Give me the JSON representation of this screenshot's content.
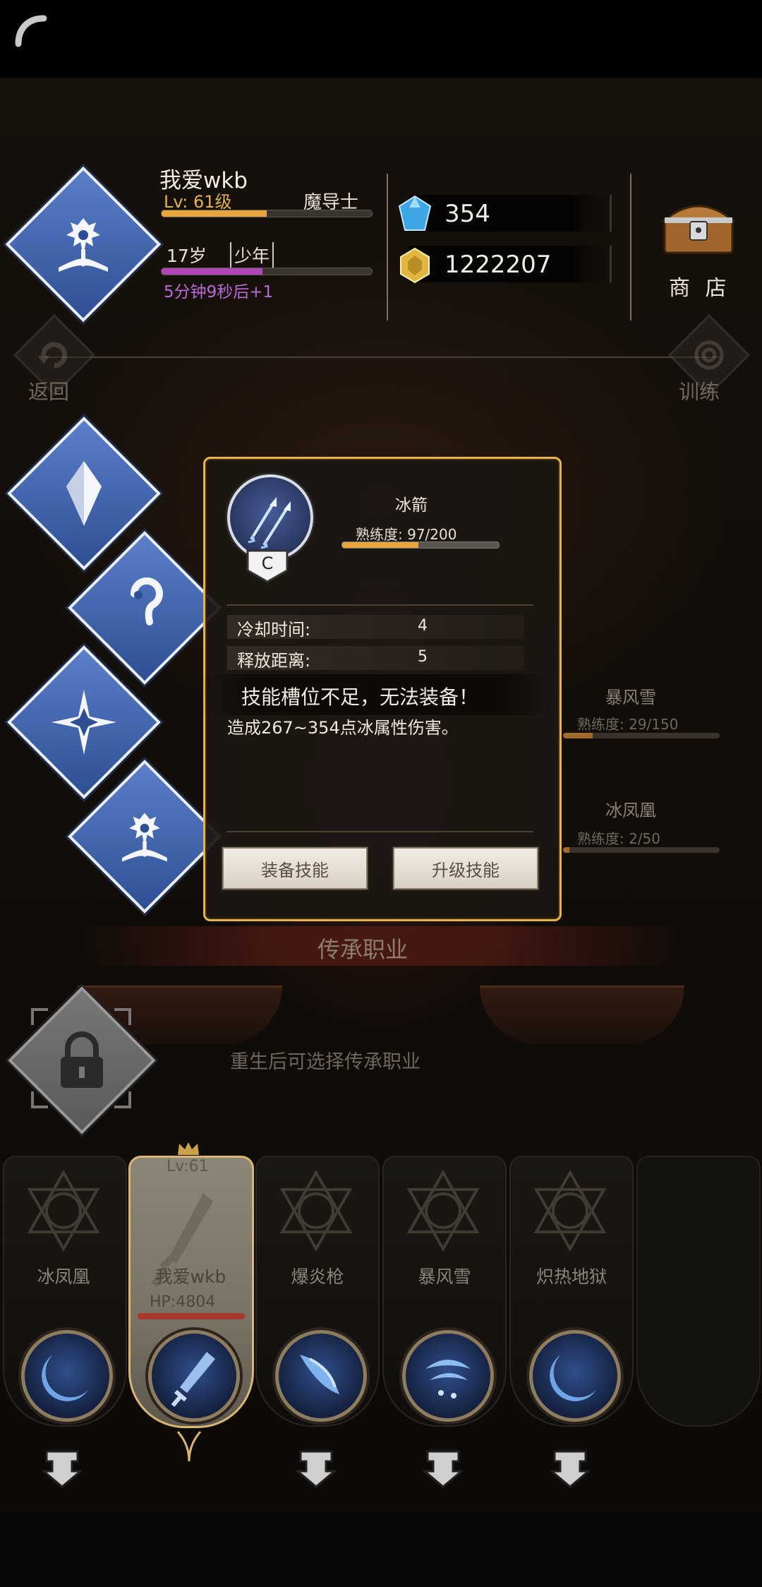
{
  "player": {
    "name": "我爱wkb",
    "level": "Lv: 61级",
    "class": "魔导士",
    "exp_progress": 0.5,
    "age": "17岁",
    "stage": "少年",
    "age_progress": 0.48,
    "timer": "5分钟9秒后+1"
  },
  "currency": {
    "gems": "354",
    "gold": "1222207"
  },
  "nav": {
    "shop": "商 店",
    "back": "返回",
    "train": "训练"
  },
  "background_skills": [
    {
      "name": "暴风雪",
      "proficiency": "熟练度: 29/150",
      "progress": 0.19
    },
    {
      "name": "冰凤凰",
      "proficiency": "熟练度: 2/50",
      "progress": 0.04
    }
  ],
  "toast": "技能槽位不足，无法装备！",
  "modal": {
    "skill_name": "冰箭",
    "proficiency_label": "熟练度: 97/200",
    "proficiency_progress": 0.485,
    "grade": "C",
    "stats": [
      {
        "label": "冷却时间:",
        "value": "4"
      },
      {
        "label": "释放距离:",
        "value": "5"
      }
    ],
    "description": "造成267~354点冰属性伤害。",
    "equip_button": "装备技能",
    "upgrade_button": "升级技能"
  },
  "inheritance": {
    "title": "传承职业",
    "hint": "重生后可选择传承职业"
  },
  "cards": [
    {
      "name": "冰凤凰"
    },
    {
      "name": "我爱wkb",
      "level": "Lv:61",
      "hp": "HP:4804"
    },
    {
      "name": "爆炎枪"
    },
    {
      "name": "暴风雪"
    },
    {
      "name": "炽热地狱"
    }
  ],
  "colors": {
    "accent_gold": "#e7b34d",
    "exp_bar": "#e7a53c",
    "age_bar": "#b044b8",
    "diamond_blue": "#3d5fa8"
  }
}
